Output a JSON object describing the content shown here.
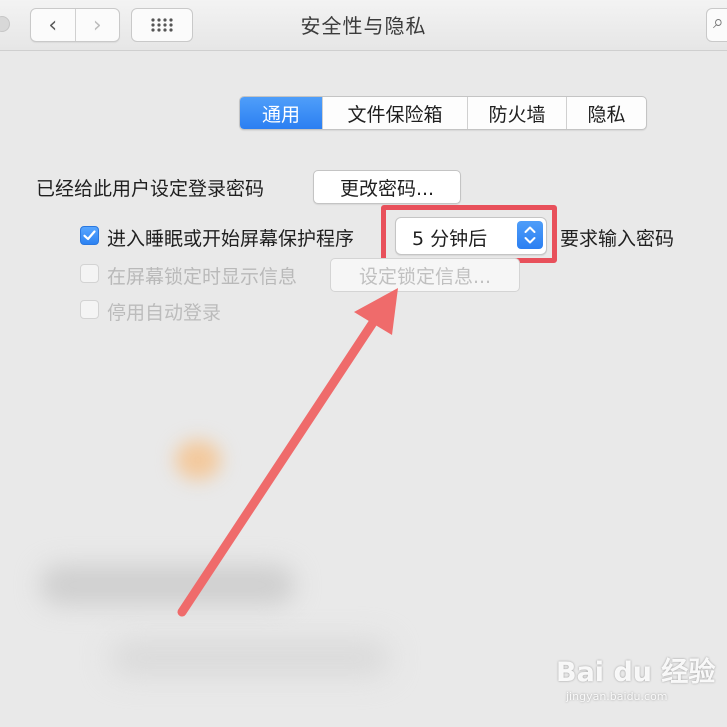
{
  "window": {
    "title": "安全性与隐私",
    "back_glyph": "‹",
    "forward_glyph": "›",
    "search_glyph": "⌕"
  },
  "tabs": [
    {
      "label": "通用",
      "active": true
    },
    {
      "label": "文件保险箱",
      "active": false
    },
    {
      "label": "防火墙",
      "active": false
    },
    {
      "label": "隐私",
      "active": false
    }
  ],
  "general": {
    "password_set_label": "已经给此用户设定登录密码",
    "change_password_button": "更改密码...",
    "require_password": {
      "checked": true,
      "label": "进入睡眠或开始屏幕保护程序",
      "delay_value": "5 分钟后",
      "tail_label": "要求输入密码"
    },
    "show_message": {
      "checked": false,
      "enabled": false,
      "label": "在屏幕锁定时显示信息",
      "button": "设定锁定信息..."
    },
    "disable_autologin": {
      "checked": false,
      "enabled": false,
      "label": "停用自动登录"
    }
  },
  "annotation": {
    "highlight_color": "#e8505b",
    "arrow_color": "#ef6b6b"
  },
  "watermark": {
    "main": "Bai du 经验",
    "sub": "jingyan.baidu.com"
  },
  "colors": {
    "accent": "#2b7ff2",
    "window_bg": "#e9e9e9"
  }
}
